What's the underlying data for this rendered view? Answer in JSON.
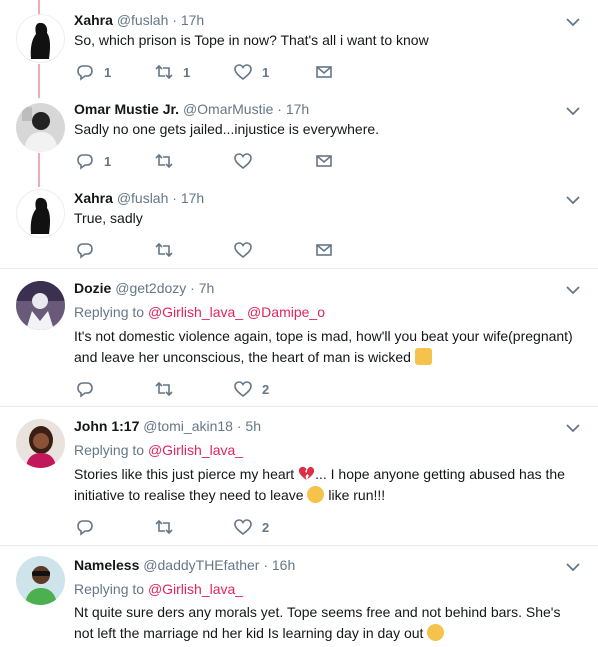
{
  "tweets": [
    {
      "name": "Xahra",
      "handle": "@fuslah",
      "dot": "·",
      "time": "17h",
      "text": "So, which prison is Tope in now?  That's all i want to know",
      "replies": "1",
      "retweets": "1",
      "likes": "1"
    },
    {
      "name": "Omar Mustie Jr.",
      "handle": "@OmarMustie",
      "dot": "·",
      "time": "17h",
      "text": "Sadly no one gets jailed...injustice is everywhere.",
      "replies": "1",
      "retweets": "",
      "likes": ""
    },
    {
      "name": "Xahra",
      "handle": "@fuslah",
      "dot": "·",
      "time": "17h",
      "text": "True, sadly",
      "replies": "",
      "retweets": "",
      "likes": ""
    },
    {
      "name": "Dozie",
      "handle": "@get2dozy",
      "dot": "·",
      "time": "7h",
      "replying_label": "Replying to",
      "mention1": "@Girlish_lava_",
      "mention2": "@Damipe_o",
      "text": "It's not domestic violence again, tope is mad, how'll you beat your wife(pregnant) and leave her unconscious, the heart of man is wicked",
      "replies": "",
      "retweets": "",
      "likes": "2"
    },
    {
      "name": "John 1:17",
      "handle": "@tomi_akin18",
      "dot": "·",
      "time": "5h",
      "replying_label": "Replying to",
      "mention1": "@Girlish_lava_",
      "text_part1": "Stories like this just pierce my heart",
      "text_part2": "... I hope anyone getting abused has the initiative to realise they need to leave",
      "text_part3": " like run!!!",
      "replies": "",
      "retweets": "",
      "likes": "2"
    },
    {
      "name": "Nameless",
      "handle": "@daddyTHEfather",
      "dot": "·",
      "time": "16h",
      "replying_label": "Replying to",
      "mention1": "@Girlish_lava_",
      "text": "Nt quite sure ders any morals yet. Tope seems free and not behind bars. She's not left the marriage nd her kid Is learning day in day out"
    }
  ],
  "icons": {
    "reply": "reply-icon",
    "retweet": "retweet-icon",
    "like": "heart-icon",
    "dm": "envelope-icon",
    "more": "chevron-down-icon"
  },
  "colors": {
    "thread_line": "#f4a9b5",
    "mention": "#e0245e",
    "muted": "#657786",
    "divider": "#e6ecf0"
  }
}
